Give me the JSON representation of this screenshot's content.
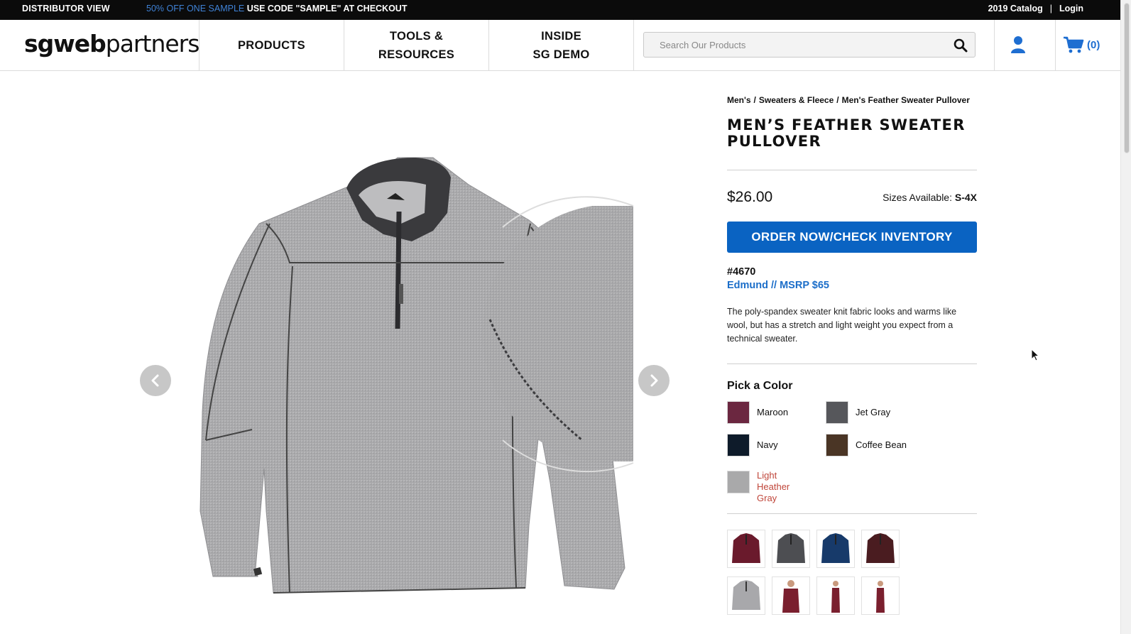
{
  "topbar": {
    "distributor": "DISTRIBUTOR VIEW",
    "promo_highlight": "50% OFF ONE SAMPLE",
    "promo_code": "USE CODE \"SAMPLE\" AT CHECKOUT",
    "catalog": "2019 Catalog",
    "separator": "|",
    "login": "Login"
  },
  "header": {
    "logo_bold": "sg",
    "logo_mid": "web",
    "logo_light": "partners",
    "nav": [
      "PRODUCTS",
      "TOOLS &\nRESOURCES",
      "INSIDE\nSG DEMO"
    ],
    "search_placeholder": "Search Our Products",
    "cart_count": "(0)"
  },
  "product": {
    "breadcrumb": [
      "Men's",
      "Sweaters & Fleece",
      "Men's Feather Sweater Pullover"
    ],
    "breadcrumb_sep": "/",
    "title": "MEN’S FEATHER SWEATER PULLOVER",
    "price": "$26.00",
    "sizes_label": "Sizes Available:",
    "sizes_value": "S-4X",
    "order_button": "ORDER NOW/CHECK INVENTORY",
    "sku": "#4670",
    "msrp": "Edmund // MSRP $65",
    "description": "The poly-spandex sweater knit fabric looks and warms like wool, but has a stretch and light weight you expect from a technical sweater.",
    "pick_color_label": "Pick a Color",
    "colors": [
      {
        "name": "Maroon",
        "hex": "#6b2740"
      },
      {
        "name": "Jet Gray",
        "hex": "#56575b"
      },
      {
        "name": "Navy",
        "hex": "#0e1b2a"
      },
      {
        "name": "Coffee Bean",
        "hex": "#4a3525"
      },
      {
        "name": "Light Heather Gray",
        "hex": "#a9a9aa",
        "selected": true
      }
    ],
    "thumb_colors": [
      "#6a1a2c",
      "#4d4e52",
      "#173a6a",
      "#4a1c20",
      "#a8a8ab",
      "#7a1f2e",
      "#7a1f2e",
      "#7a1f2e"
    ]
  },
  "theme": {
    "accent": "#0a63c2",
    "link": "#1c6ec9",
    "topbar_bg": "#0b0b0b",
    "selected_color_text": "#c0463a"
  }
}
